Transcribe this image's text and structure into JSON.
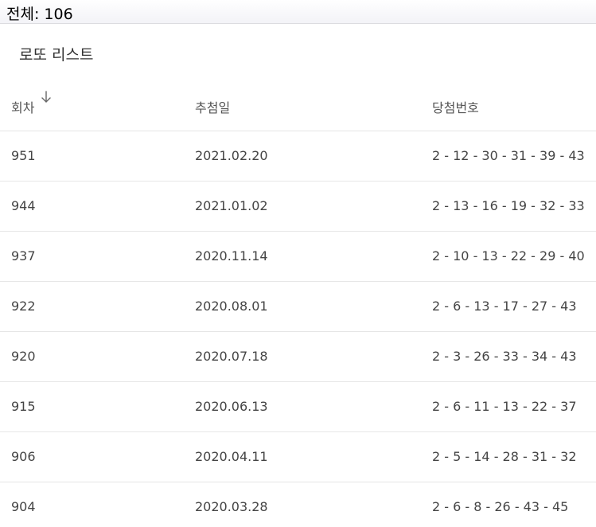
{
  "header": {
    "total_label": "전체: 106"
  },
  "list": {
    "title": "로또 리스트",
    "columns": {
      "round": "회차",
      "date": "추첨일",
      "numbers": "당첨번호"
    },
    "rows": [
      {
        "round": "951",
        "date": "2021.02.20",
        "numbers": "2 - 12 - 30 - 31 - 39 - 43"
      },
      {
        "round": "944",
        "date": "2021.01.02",
        "numbers": "2 - 13 - 16 - 19 - 32 - 33"
      },
      {
        "round": "937",
        "date": "2020.11.14",
        "numbers": "2 - 10 - 13 - 22 - 29 - 40"
      },
      {
        "round": "922",
        "date": "2020.08.01",
        "numbers": "2 - 6 - 13 - 17 - 27 - 43"
      },
      {
        "round": "920",
        "date": "2020.07.18",
        "numbers": "2 - 3 - 26 - 33 - 34 - 43"
      },
      {
        "round": "915",
        "date": "2020.06.13",
        "numbers": "2 - 6 - 11 - 13 - 22 - 37"
      },
      {
        "round": "906",
        "date": "2020.04.11",
        "numbers": "2 - 5 - 14 - 28 - 31 - 32"
      },
      {
        "round": "904",
        "date": "2020.03.28",
        "numbers": "2 - 6 - 8 - 26 - 43 - 45"
      }
    ]
  },
  "icons": {
    "sort": "arrow-down-icon"
  }
}
